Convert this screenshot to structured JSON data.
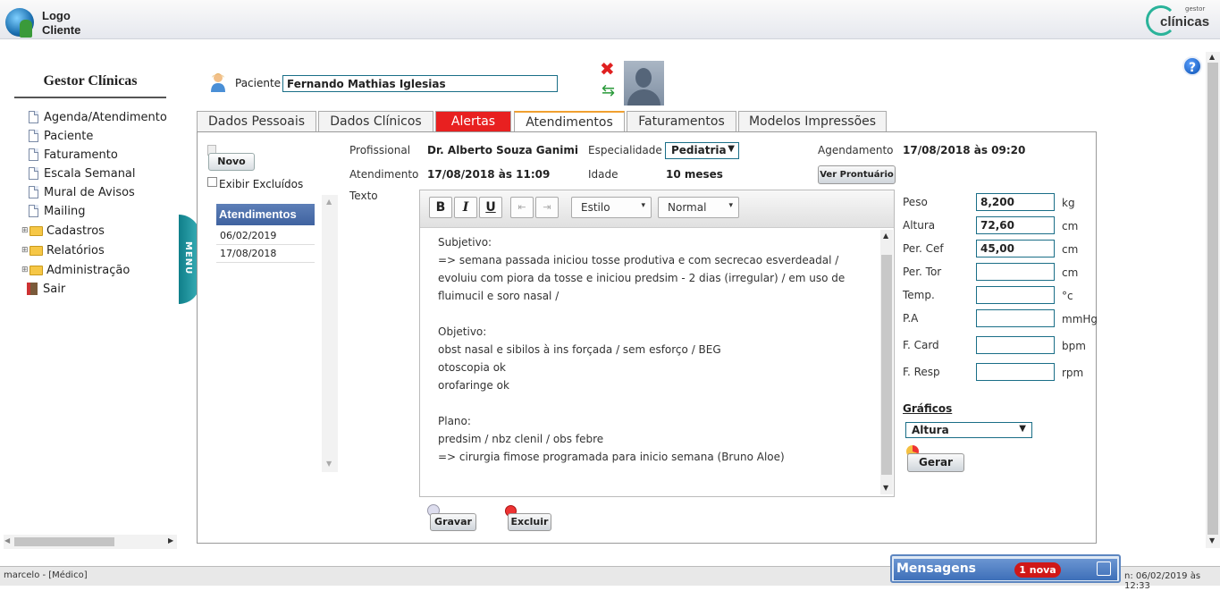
{
  "header": {
    "logo_line1": "Logo",
    "logo_line2": "Cliente",
    "brand_small": "gestor",
    "brand_name": "clínicas"
  },
  "sidebar": {
    "title": "Gestor Clínicas",
    "items": [
      {
        "label": "Agenda/Atendimento",
        "type": "doc"
      },
      {
        "label": "Paciente",
        "type": "doc"
      },
      {
        "label": "Faturamento",
        "type": "doc"
      },
      {
        "label": "Escala Semanal",
        "type": "doc"
      },
      {
        "label": "Mural de Avisos",
        "type": "doc"
      },
      {
        "label": "Mailing",
        "type": "doc"
      },
      {
        "label": "Cadastros",
        "type": "folder"
      },
      {
        "label": "Relatórios",
        "type": "folder"
      },
      {
        "label": "Administração",
        "type": "folder"
      },
      {
        "label": "Sair",
        "type": "exit"
      }
    ],
    "menu_tab": "MENU"
  },
  "patient": {
    "label": "Paciente",
    "name": "Fernando Mathias Iglesias"
  },
  "tabs": [
    "Dados Pessoais",
    "Dados Clínicos",
    "Alertas",
    "Atendimentos",
    "Faturamentos",
    "Modelos Impressões"
  ],
  "left_panel": {
    "new_label": "Novo",
    "show_excluded": "Exibir Excluídos",
    "list_header": "Atendimentos",
    "dates": [
      "06/02/2019",
      "17/08/2018"
    ]
  },
  "details": {
    "profissional_label": "Profissional",
    "profissional": "Dr. Alberto Souza Ganimi",
    "especialidade_label": "Especialidade",
    "especialidade": "Pediatria",
    "agendamento_label": "Agendamento",
    "agendamento": "17/08/2018 às 09:20",
    "atendimento_label": "Atendimento",
    "atendimento": "17/08/2018 às 11:09",
    "idade_label": "Idade",
    "idade": "10 meses",
    "ver_prontuario": "Ver Prontuário",
    "texto_label": "Texto"
  },
  "editor": {
    "bold": "B",
    "italic": "I",
    "underline": "U",
    "style_select": "Estilo",
    "format_select": "Normal",
    "lines": [
      "Subjetivo:",
      "=> semana passada iniciou tosse produtiva e com secrecao esverdeadal / evoluiu com piora da tosse e iniciou predsim - 2 dias (irregular) / em uso de fluimucil e soro nasal /",
      "",
      "Objetivo:",
      "obst nasal e sibilos à ins forçada / sem esforço / BEG",
      "otoscopia ok",
      "orofaringe ok",
      "",
      "Plano:",
      "predsim / nbz clenil / obs febre",
      "=> cirurgia fimose programada para inicio semana (Bruno Aloe)"
    ]
  },
  "actions": {
    "gravar": "Gravar",
    "excluir": "Excluir"
  },
  "vitals": [
    {
      "label": "Peso",
      "value": "8,200",
      "unit": "kg"
    },
    {
      "label": "Altura",
      "value": "72,60",
      "unit": "cm"
    },
    {
      "label": "Per. Cef",
      "value": "45,00",
      "unit": "cm"
    },
    {
      "label": "Per. Tor",
      "value": "",
      "unit": "cm"
    },
    {
      "label": "Temp.",
      "value": "",
      "unit": "°c"
    },
    {
      "label": "P.A",
      "value": "",
      "unit": "mmHg"
    },
    {
      "label": "F. Card",
      "value": "",
      "unit": "bpm"
    },
    {
      "label": "F. Resp",
      "value": "",
      "unit": "rpm"
    }
  ],
  "graphs": {
    "title": "Gráficos",
    "selected": "Altura",
    "generate": "Gerar"
  },
  "status": {
    "user": "marcelo - [Médico]",
    "date": "n: 06/02/2019  às 12:33"
  },
  "messages": {
    "title": "Mensagens",
    "badge": "1 nova"
  },
  "colors": {
    "accent": "#1a6e87",
    "alert": "#e82020",
    "list_header": "#4a6fad"
  }
}
